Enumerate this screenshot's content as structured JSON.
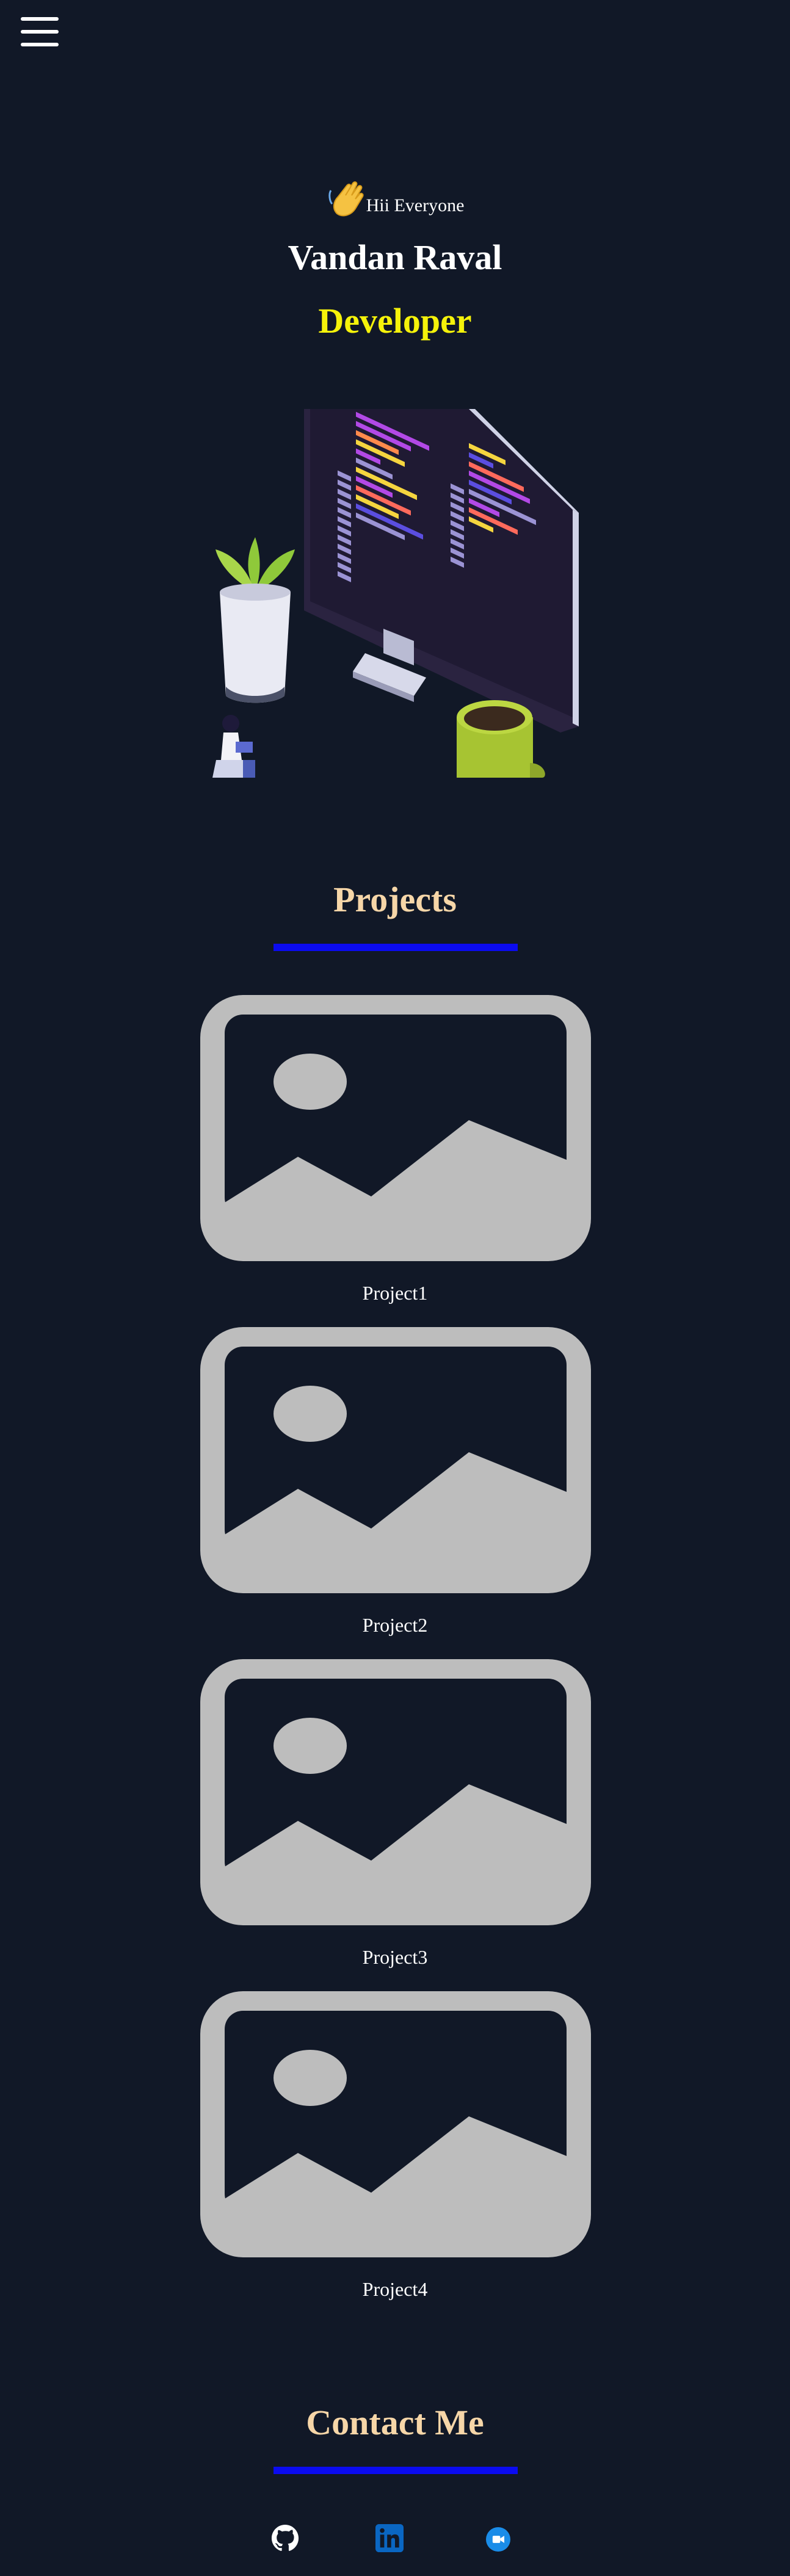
{
  "nav": {
    "menu_icon": "hamburger-menu-icon"
  },
  "hero": {
    "wave_icon": "waving-hand-icon",
    "greeting": "Hii Everyone",
    "name": "Vandan Raval",
    "role": "Developer",
    "illustration": "developer-desk-illustration"
  },
  "projects": {
    "title": "Projects",
    "items": [
      {
        "label": "Project1",
        "icon": "image-placeholder-icon"
      },
      {
        "label": "Project2",
        "icon": "image-placeholder-icon"
      },
      {
        "label": "Project3",
        "icon": "image-placeholder-icon"
      },
      {
        "label": "Project4",
        "icon": "image-placeholder-icon"
      }
    ]
  },
  "contact": {
    "title": "Contact Me",
    "links": [
      {
        "icon": "github-icon"
      },
      {
        "icon": "linkedin-icon"
      },
      {
        "icon": "video-call-icon"
      }
    ]
  },
  "colors": {
    "background": "#111827",
    "accent_yellow": "#f5f20a",
    "heading_peach": "#f6d6a8",
    "underline_blue": "#0b0bf0",
    "placeholder_gray": "#bdbdbd"
  }
}
